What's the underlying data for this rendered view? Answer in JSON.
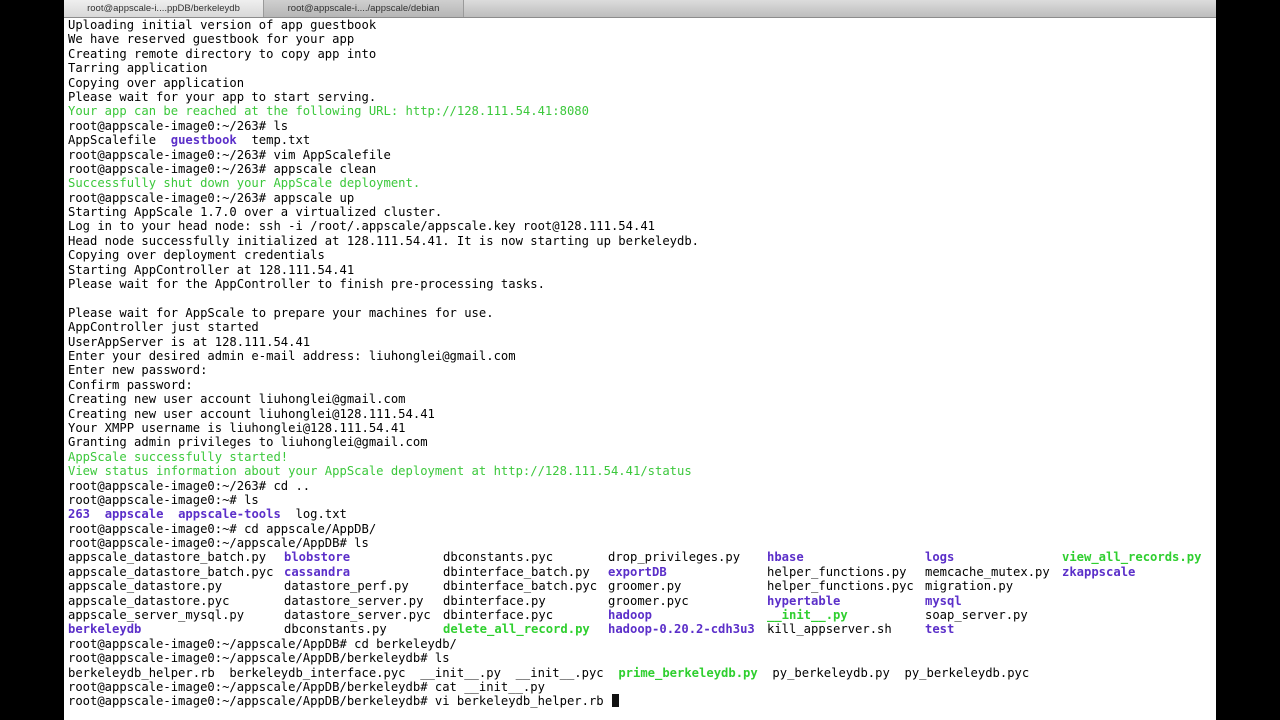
{
  "tabs": [
    {
      "label": "root@appscale-i....ppDB/berkeleydb"
    },
    {
      "label": "root@appscale-i..../appscale/debian"
    }
  ],
  "lines": [
    {
      "text": "Uploading initial version of app guestbook"
    },
    {
      "text": "We have reserved guestbook for your app"
    },
    {
      "text": "Creating remote directory to copy app into"
    },
    {
      "text": "Tarring application"
    },
    {
      "text": "Copying over application"
    },
    {
      "text": "Please wait for your app to start serving."
    },
    {
      "text": "Your app can be reached at the following URL: http://128.111.54.41:8080",
      "style": "g"
    },
    {
      "text": "root@appscale-image0:~/263# ls"
    },
    {
      "segments": [
        {
          "t": "AppScalefile  "
        },
        {
          "t": "guestbook",
          "s": "dir"
        },
        {
          "t": "  temp.txt"
        }
      ]
    },
    {
      "text": "root@appscale-image0:~/263# vim AppScalefile"
    },
    {
      "text": "root@appscale-image0:~/263# appscale clean"
    },
    {
      "text": "Successfully shut down your AppScale deployment.",
      "style": "g"
    },
    {
      "text": "root@appscale-image0:~/263# appscale up"
    },
    {
      "text": "Starting AppScale 1.7.0 over a virtualized cluster."
    },
    {
      "text": "Log in to your head node: ssh -i /root/.appscale/appscale.key root@128.111.54.41"
    },
    {
      "text": "Head node successfully initialized at 128.111.54.41. It is now starting up berkeleydb."
    },
    {
      "text": "Copying over deployment credentials"
    },
    {
      "text": "Starting AppController at 128.111.54.41"
    },
    {
      "text": "Please wait for the AppController to finish pre-processing tasks."
    },
    {
      "text": ""
    },
    {
      "text": "Please wait for AppScale to prepare your machines for use."
    },
    {
      "text": "AppController just started"
    },
    {
      "text": "UserAppServer is at 128.111.54.41"
    },
    {
      "text": "Enter your desired admin e-mail address: liuhonglei@gmail.com"
    },
    {
      "text": "Enter new password:"
    },
    {
      "text": "Confirm password:"
    },
    {
      "text": "Creating new user account liuhonglei@gmail.com"
    },
    {
      "text": "Creating new user account liuhonglei@128.111.54.41"
    },
    {
      "text": "Your XMPP username is liuhonglei@128.111.54.41"
    },
    {
      "text": "Granting admin privileges to liuhonglei@gmail.com"
    },
    {
      "text": "AppScale successfully started!",
      "style": "g"
    },
    {
      "text": "View status information about your AppScale deployment at http://128.111.54.41/status",
      "style": "g"
    },
    {
      "text": "root@appscale-image0:~/263# cd .."
    },
    {
      "text": "root@appscale-image0:~# ls"
    },
    {
      "segments": [
        {
          "t": "263",
          "s": "dir"
        },
        {
          "t": "  "
        },
        {
          "t": "appscale",
          "s": "dir"
        },
        {
          "t": "  "
        },
        {
          "t": "appscale-tools",
          "s": "dir"
        },
        {
          "t": "  log.txt"
        }
      ]
    },
    {
      "text": "root@appscale-image0:~# cd appscale/AppDB/"
    },
    {
      "text": "root@appscale-image0:~/appscale/AppDB# ls"
    },
    {
      "grid": [
        {
          "t": "appscale_datastore_batch.py"
        },
        {
          "t": "blobstore",
          "s": "dir"
        },
        {
          "t": "dbconstants.pyc"
        },
        {
          "t": "drop_privileges.py"
        },
        {
          "t": "hbase",
          "s": "dir"
        },
        {
          "t": "logs",
          "s": "dir"
        },
        {
          "t": "view_all_records.py",
          "s": "exe"
        }
      ]
    },
    {
      "grid": [
        {
          "t": "appscale_datastore_batch.pyc"
        },
        {
          "t": "cassandra",
          "s": "dir"
        },
        {
          "t": "dbinterface_batch.py"
        },
        {
          "t": "exportDB",
          "s": "dir"
        },
        {
          "t": "helper_functions.py"
        },
        {
          "t": "memcache_mutex.py"
        },
        {
          "t": "zkappscale",
          "s": "dir"
        }
      ]
    },
    {
      "grid": [
        {
          "t": "appscale_datastore.py"
        },
        {
          "t": "datastore_perf.py"
        },
        {
          "t": "dbinterface_batch.pyc"
        },
        {
          "t": "groomer.py"
        },
        {
          "t": "helper_functions.pyc"
        },
        {
          "t": "migration.py"
        },
        {
          "t": ""
        }
      ]
    },
    {
      "grid": [
        {
          "t": "appscale_datastore.pyc"
        },
        {
          "t": "datastore_server.py"
        },
        {
          "t": "dbinterface.py"
        },
        {
          "t": "groomer.pyc"
        },
        {
          "t": "hypertable",
          "s": "dir"
        },
        {
          "t": "mysql",
          "s": "dir"
        },
        {
          "t": ""
        }
      ]
    },
    {
      "grid": [
        {
          "t": "appscale_server_mysql.py"
        },
        {
          "t": "datastore_server.pyc"
        },
        {
          "t": "dbinterface.pyc"
        },
        {
          "t": "hadoop",
          "s": "dir"
        },
        {
          "t": "__init__.py",
          "s": "exe"
        },
        {
          "t": "soap_server.py"
        },
        {
          "t": ""
        }
      ]
    },
    {
      "grid": [
        {
          "t": "berkeleydb",
          "s": "dir"
        },
        {
          "t": "dbconstants.py"
        },
        {
          "t": "delete_all_record.py",
          "s": "exe"
        },
        {
          "t": "hadoop-0.20.2-cdh3u3",
          "s": "dir"
        },
        {
          "t": "kill_appserver.sh"
        },
        {
          "t": "test",
          "s": "dir"
        },
        {
          "t": ""
        }
      ]
    },
    {
      "text": "root@appscale-image0:~/appscale/AppDB# cd berkeleydb/"
    },
    {
      "text": "root@appscale-image0:~/appscale/AppDB/berkeleydb# ls"
    },
    {
      "segments": [
        {
          "t": "berkeleydb_helper.rb  berkeleydb_interface.pyc  __init__.py  __init__.pyc  "
        },
        {
          "t": "prime_berkeleydb.py",
          "s": "exe"
        },
        {
          "t": "  py_berkeleydb.py  py_berkeleydb.pyc"
        }
      ]
    },
    {
      "text": "root@appscale-image0:~/appscale/AppDB/berkeleydb# cat __init__.py"
    },
    {
      "text": "root@appscale-image0:~/appscale/AppDB/berkeleydb# vi berkeleydb_helper.rb ",
      "cursor": true
    }
  ]
}
